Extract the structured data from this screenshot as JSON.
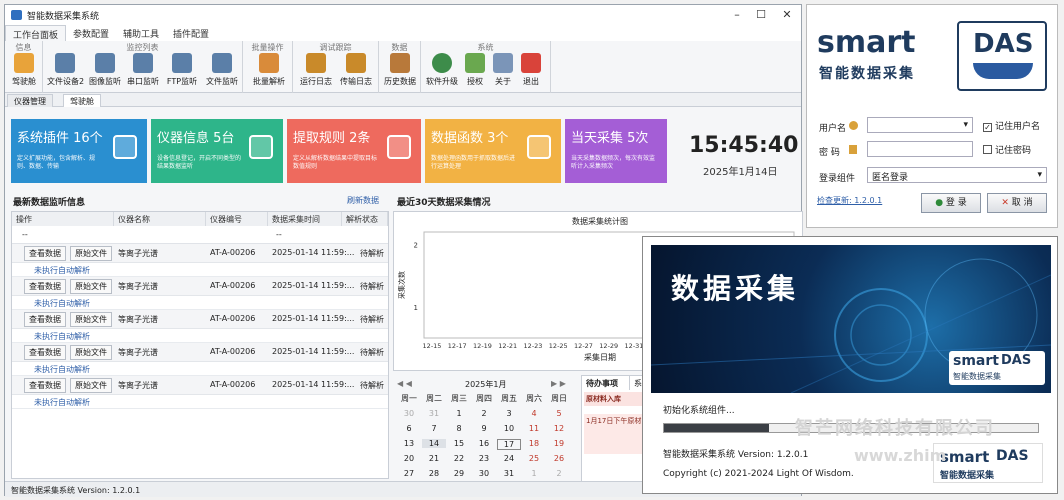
{
  "main": {
    "title": "智能数据采集系统",
    "menu_tabs": [
      "工作台面板",
      "参数配置",
      "辅助工具",
      "插件配置"
    ],
    "ribbon_groups": [
      "信息",
      "监控列表",
      "批量操作",
      "调试跟踪",
      "数据",
      "系统"
    ],
    "ribbon_buttons": [
      "驾驶舱",
      "文件设备2",
      "图像监听",
      "串口监听",
      "FTP监听",
      "文件监听",
      "批量解析",
      "运行日志",
      "传输日志",
      "历史数据",
      "软件升级",
      "授权",
      "关于",
      "退出"
    ],
    "doc_tabs": [
      "仪器管理",
      "驾驶舱"
    ],
    "tiles": [
      {
        "title": "系统插件 16个",
        "desc": "定义扩展功能，包含解析、规则、数据、传输",
        "color": "#2a8fd0"
      },
      {
        "title": "仪器信息 5台",
        "desc": "设备信息登记，开启不同类型的结果数据监听",
        "color": "#2eb58a"
      },
      {
        "title": "提取规则 2条",
        "desc": "定义从解析数据结果中提取目标数值规则",
        "color": "#ee6a5e"
      },
      {
        "title": "数据函数 3个",
        "desc": "数据处理函数用于抓取数据后进行运算处理",
        "color": "#f2b244"
      },
      {
        "title": "当天采集 5次",
        "desc": "当天采集数据频次，每次有效监听计入采集频次",
        "color": "#a45ed6"
      }
    ],
    "clock": "15:45:40",
    "date": "2025年1月14日",
    "grid": {
      "title": "最新数据监听信息",
      "refresh": "刷新数据",
      "headers": [
        "操作",
        "仪器名称",
        "仪器编号",
        "数据采集时间",
        "解析状态"
      ],
      "filter_text": "--",
      "view_btn": "查看数据",
      "raw_btn": "原始文件",
      "note": "未执行自动解析",
      "rows": [
        {
          "name": "等离子光谱",
          "code": "AT-A-00206",
          "time": "2025-01-14 11:59:...",
          "status": "待解析"
        },
        {
          "name": "等离子光谱",
          "code": "AT-A-00206",
          "time": "2025-01-14 11:59:...",
          "status": "待解析"
        },
        {
          "name": "等离子光谱",
          "code": "AT-A-00206",
          "time": "2025-01-14 11:59:...",
          "status": "待解析"
        },
        {
          "name": "等离子光谱",
          "code": "AT-A-00206",
          "time": "2025-01-14 11:59:...",
          "status": "待解析"
        },
        {
          "name": "等离子光谱",
          "code": "AT-A-00206",
          "time": "2025-01-14 11:59:...",
          "status": "待解析"
        }
      ]
    },
    "chart_panel_title": "最近30天数据采集情况",
    "calendar": {
      "month": "2025年1月",
      "weekdays": [
        "周一",
        "周二",
        "周三",
        "周四",
        "周五",
        "周六",
        "周日"
      ],
      "days": [
        "30",
        "31",
        "1",
        "2",
        "3",
        "4",
        "5",
        "6",
        "7",
        "8",
        "9",
        "10",
        "11",
        "12",
        "13",
        "14",
        "15",
        "16",
        "17",
        "18",
        "19",
        "20",
        "21",
        "22",
        "23",
        "24",
        "25",
        "26",
        "27",
        "28",
        "29",
        "30",
        "31",
        "1",
        "2"
      ]
    },
    "todo": {
      "tabs": [
        "待办事项",
        "系"
      ],
      "item1": "原材料入库",
      "item2": "1月17日下午原材"
    },
    "status": "智能数据采集系统 Version: 1.2.0.1"
  },
  "chart_data": {
    "type": "line",
    "title": "数据采集统计图",
    "xlabel": "采集日期",
    "ylabel": "采集次数",
    "categories": [
      "12-15",
      "12-17",
      "12-19",
      "12-21",
      "12-23",
      "12-25",
      "12-27",
      "12-29",
      "12-31"
    ],
    "yticks": [
      "1",
      "2"
    ],
    "ylim": [
      0.5,
      2.2
    ],
    "values": [],
    "grid": false
  },
  "login": {
    "logo_smart": "smart",
    "logo_das": "DAS",
    "logo_sub": "智能数据采集",
    "user_label": "用户名",
    "pwd_label": "密  码",
    "remember_user": "记住用户名",
    "remember_pwd": "记住密码",
    "component_label": "登录组件",
    "component_value": "匿名登录",
    "update_link": "检查更新: 1.2.0.1",
    "login_btn": "登 录",
    "cancel_btn": "取 消"
  },
  "splash": {
    "banner_title": "数据采集",
    "loading": "初始化系统组件...",
    "progress": 0.28,
    "version": "智能数据采集系统 Version: 1.2.0.1",
    "copyright": "Copyright (c) 2021-2024 Light Of Wisdom.",
    "logo_smart": "smart",
    "logo_das": "DAS",
    "logo_sub": "智能数据采集"
  },
  "watermark": {
    "line1": "智芒网络科技有限公司",
    "line2": "www.zhim"
  }
}
